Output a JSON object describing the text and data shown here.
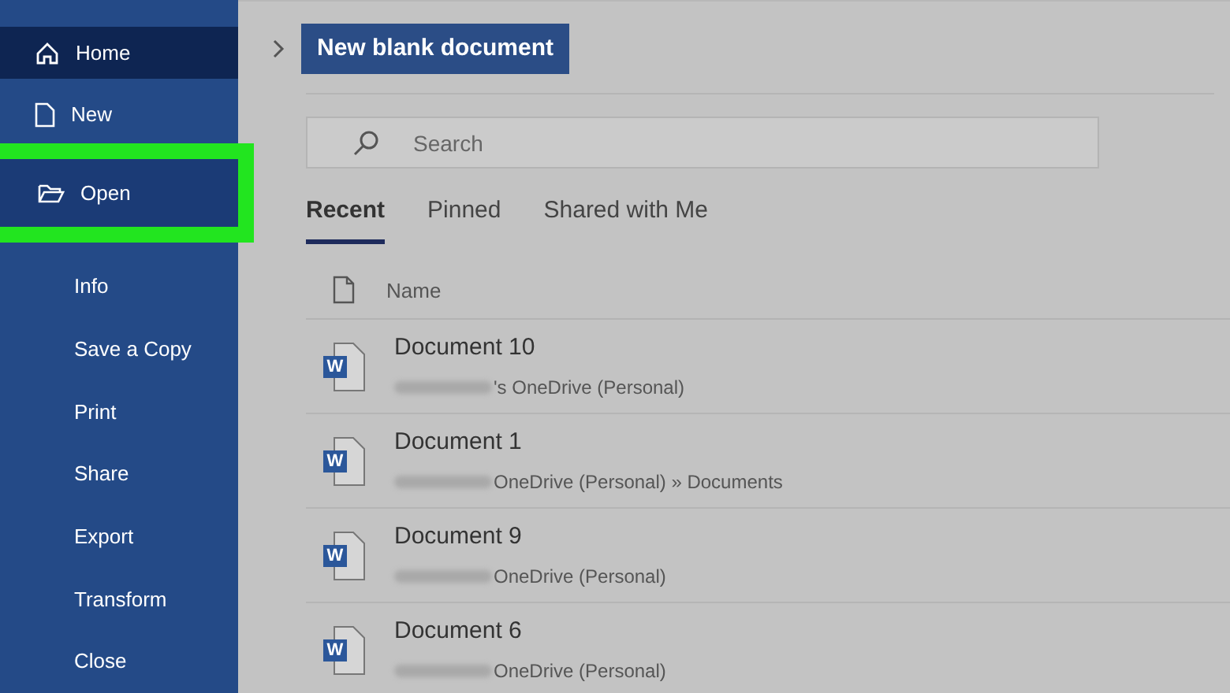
{
  "sidebar": {
    "items": [
      {
        "label": "Home",
        "kind": "icon",
        "selected": true,
        "highlighted": false
      },
      {
        "label": "New",
        "kind": "icon",
        "selected": false,
        "highlighted": false
      },
      {
        "label": "Open",
        "kind": "icon",
        "selected": false,
        "highlighted": true
      },
      {
        "label": "Info",
        "selected": false,
        "highlighted": false
      },
      {
        "label": "Save a Copy",
        "selected": false,
        "highlighted": false
      },
      {
        "label": "Print",
        "selected": false,
        "highlighted": false
      },
      {
        "label": "Share",
        "selected": false,
        "highlighted": false
      },
      {
        "label": "Export",
        "selected": false,
        "highlighted": false
      },
      {
        "label": "Transform",
        "selected": false,
        "highlighted": false
      },
      {
        "label": "Close",
        "selected": false,
        "highlighted": false
      }
    ]
  },
  "new_button": {
    "label": "New blank document"
  },
  "search": {
    "placeholder": "Search"
  },
  "tabs": [
    {
      "label": "Recent",
      "selected": true
    },
    {
      "label": "Pinned",
      "selected": false
    },
    {
      "label": "Shared with Me",
      "selected": false
    }
  ],
  "table": {
    "columns": [
      "Name"
    ],
    "rows": [
      {
        "icon_letter": "W",
        "name": "Document 10",
        "location": "'s OneDrive (Personal)"
      },
      {
        "icon_letter": "W",
        "name": "Document 1",
        "location": "OneDrive (Personal) » Documents"
      },
      {
        "icon_letter": "W",
        "name": "Document 9",
        "location": "OneDrive (Personal)"
      },
      {
        "icon_letter": "W",
        "name": "Document 6",
        "location": "OneDrive (Personal)"
      }
    ]
  }
}
